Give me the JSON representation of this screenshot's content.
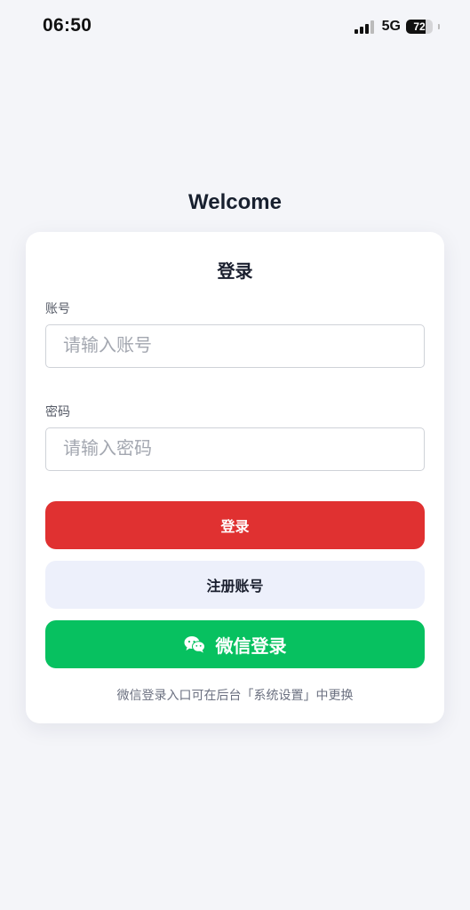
{
  "status_bar": {
    "time": "06:50",
    "network": "5G",
    "battery_level": "72",
    "battery_fraction": 0.72
  },
  "page": {
    "heading": "Welcome"
  },
  "login_card": {
    "title": "登录",
    "account": {
      "label": "账号",
      "placeholder": "请输入账号",
      "value": ""
    },
    "password": {
      "label": "密码",
      "placeholder": "请输入密码",
      "value": ""
    },
    "login_button_label": "登录",
    "register_button_label": "注册账号",
    "wechat_button_label": "微信登录",
    "wechat_icon": "wechat-icon",
    "hint": "微信登录入口可在后台「系统设置」中更换"
  },
  "colors": {
    "background": "#f4f5f9",
    "login_button": "#e03131",
    "register_button": "#edf0fb",
    "wechat_button": "#07c160"
  }
}
